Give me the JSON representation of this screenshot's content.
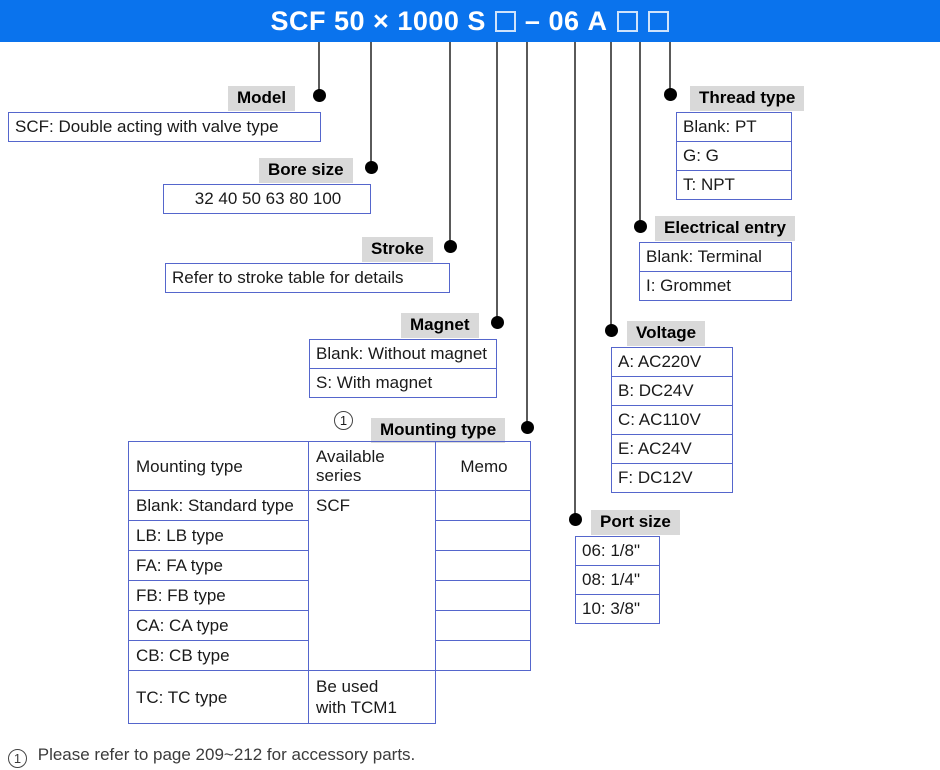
{
  "header": {
    "code_parts": [
      "SCF",
      "50",
      "×",
      "1000",
      "S"
    ],
    "code_suffix_dash": "–",
    "code_port": "06",
    "code_voltage": "A",
    "full_code": "SCF 50 × 1000 S □–06 A □ □"
  },
  "sections": {
    "model": {
      "caption": "Model",
      "rows": [
        "SCF: Double acting with valve type"
      ]
    },
    "bore_size": {
      "caption": "Bore size",
      "rows": [
        "32  40  50  63  80  100"
      ]
    },
    "stroke": {
      "caption": "Stroke",
      "rows": [
        "Refer to stroke table for details"
      ]
    },
    "magnet": {
      "caption": "Magnet",
      "rows": [
        "Blank: Without magnet",
        "S: With magnet"
      ]
    },
    "mounting_type": {
      "caption": "Mounting type",
      "note_marker": "1",
      "columns": [
        "Mounting type",
        "Available series",
        "Memo"
      ],
      "rows": [
        {
          "type": "Blank: Standard type",
          "series": "",
          "memo": ""
        },
        {
          "type": "LB: LB type",
          "series": "SCF",
          "memo": ""
        },
        {
          "type": "FA: FA type",
          "series": "",
          "memo": ""
        },
        {
          "type": "FB: FB type",
          "series": "",
          "memo": ""
        },
        {
          "type": "CA: CA type",
          "series": "",
          "memo": ""
        },
        {
          "type": "CB: CB type",
          "series": "",
          "memo": ""
        },
        {
          "type": "TC: TC type",
          "series": "",
          "memo": "Be used\nwith TCM1"
        }
      ]
    },
    "thread_type": {
      "caption": "Thread type",
      "rows": [
        "Blank: PT",
        "G: G",
        "T: NPT"
      ]
    },
    "electrical_entry": {
      "caption": "Electrical entry",
      "rows": [
        "Blank: Terminal",
        "I: Grommet"
      ]
    },
    "voltage": {
      "caption": "Voltage",
      "rows": [
        "A: AC220V",
        "B: DC24V",
        "C: AC110V",
        "E: AC24V",
        "F: DC12V"
      ]
    },
    "port_size": {
      "caption": "Port size",
      "rows": [
        "06: 1/8\"",
        "08: 1/4\"",
        "10: 3/8\""
      ]
    }
  },
  "footnote": {
    "marker": "1",
    "text": "Please refer to page 209~212 for accessory parts."
  },
  "colors": {
    "header_bar": "#0a73ed",
    "caption_bg": "#d9d9d9",
    "box_border": "#5566cc",
    "leader": "#5a5a5a"
  }
}
